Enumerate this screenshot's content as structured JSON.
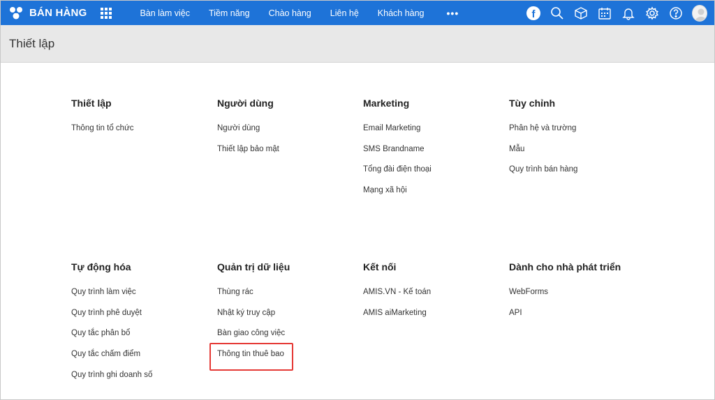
{
  "app": {
    "name": "BÁN HÀNG"
  },
  "nav": [
    "Bàn làm việc",
    "Tiềm năng",
    "Chào hàng",
    "Liên hệ",
    "Khách hàng"
  ],
  "nav_more": "•••",
  "facebook_letter": "f",
  "page_title": "Thiết lập",
  "colors": {
    "topbar": "#1e73d8",
    "header_band": "#e8e8e8",
    "highlight": "#e53935"
  },
  "sections": [
    {
      "title": "Thiết lập",
      "items": [
        "Thông tin tổ chức"
      ]
    },
    {
      "title": "Người dùng",
      "items": [
        "Người dùng",
        "Thiết lập bảo mật"
      ]
    },
    {
      "title": "Marketing",
      "items": [
        "Email Marketing",
        "SMS Brandname",
        "Tổng đài điện thoại",
        "Mạng xã hội"
      ]
    },
    {
      "title": "Tùy chỉnh",
      "items": [
        "Phân hệ và trường",
        "Mẫu",
        "Quy trình bán hàng"
      ]
    },
    {
      "title": "Tự động hóa",
      "items": [
        "Quy trình làm việc",
        "Quy trình phê duyệt",
        "Quy tắc phân bổ",
        "Quy tắc chấm điểm",
        "Quy trình ghi doanh số"
      ]
    },
    {
      "title": "Quản trị dữ liệu",
      "items": [
        "Thùng rác",
        "Nhật ký truy cập",
        "Bàn giao công việc",
        "Thông tin thuê bao"
      ]
    },
    {
      "title": "Kết nối",
      "items": [
        "AMIS.VN - Kế toán",
        "AMIS aiMarketing"
      ]
    },
    {
      "title": "Dành cho nhà phát triển",
      "items": [
        "WebForms",
        "API"
      ]
    }
  ]
}
